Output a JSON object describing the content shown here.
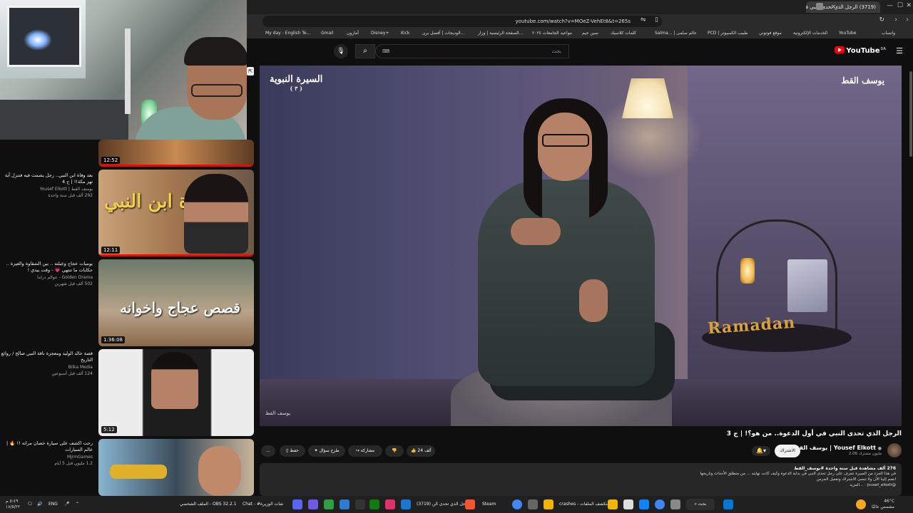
{
  "browser": {
    "tab_title": "(3719) الرجل الذي تحدى النبي في",
    "url": "youtube.com/watch?v=MOeZ-VehEt8&t=265s",
    "bookmarks": [
      "My day - English Te...",
      "Gmail",
      "أمازون",
      "Disney+",
      "Kick",
      "الوديجات | أفضل برن...",
      "الصفحة الرئيسية | وزار...",
      "مواعيد الجامعات ٢٠٢٤",
      "سين جيم",
      "كلمات كلاسيك",
      "Salma... | عالم سلمى",
      "PCD | طبيب الكمبيوتر",
      "موقع فوتوني",
      "الخدمات الإلكترونية",
      "YouTube",
      "واتساب"
    ]
  },
  "youtube": {
    "logo": "YouTube",
    "logo_region": "SA",
    "search_placeholder": "بحث"
  },
  "video": {
    "overlay_title": "السيرة النبوية",
    "overlay_sub": "( ٣ )",
    "channel_logo": "يوسف القط",
    "deco_text": "Ramadan",
    "watermark": "يوسف القط",
    "title": "الرجل الذي تحدى النبي في أول الدعوة.. من هو؟! | ج 3",
    "channel": "يوسف القط | Yousef Elkott",
    "subscribers": "2.06 مليون مشترك",
    "subscribe_label": "الاشتراك",
    "likes": "24 ألف",
    "share": "مشاركة",
    "ask": "طرح سؤال",
    "save": "حفظ",
    "more": "...",
    "desc_meta": "276 ألف مشاهدة  قبل سنة واحدة  #يوسف_القط",
    "desc_line1": "في هذا الجزء من السيرة نتعرف على رجل تحدى النبي في بداية الدعوة وكيف كانت نهايته ... من منطلق الأحداث وتاريخها",
    "desc_line2": "انضم إلينا الآن ولا تنسى الاشتراك وتفعيل الجرس",
    "desc_handle": "@jousef_elkott",
    "desc_more": "...المزيد"
  },
  "recommendations": [
    {
      "duration": "12:52",
      "title": "",
      "channel": "",
      "meta": ""
    },
    {
      "duration": "12:11",
      "title": "بعد وفاة ابن النبي.. رجل يشمت فيه فتنزل آية تهز مكة!! | ج 4",
      "channel": "يوسف القط | Yousef Elkott",
      "meta": "292 ألف  قبل سنة واحدة",
      "thumb_text": "وفاة ابن النبي"
    },
    {
      "duration": "1:36:08",
      "title": "يوميات عجاج وعيلته .. بين الشقاوة والغيرة .. حكايات ما تنتهي 💗 - وقت يبدي !",
      "channel": "Golden Drama - عوالم دراما",
      "meta": "502 ألف  قبل شهرين",
      "thumb_text": "قصص عجاج واخوانه"
    },
    {
      "duration": "5:12",
      "title": "قصة خالد الوليد ومعجزة ناقة النبي صالح / روائع التاريخ",
      "channel": "Bilka Media",
      "meta": "124 ألف  قبل أسبوعين",
      "thumb_text": ""
    },
    {
      "duration": "",
      "title": "رحت اكشف على سيارة حصان مراته !! 🔥 | عالم السيارات",
      "channel": "MjrmGames",
      "meta": "1.2 مليون  قبل 5 أيام",
      "thumb_text": ""
    }
  ],
  "taskbar": {
    "search": "بحث",
    "items": [
      "crashes - مستكشف الملفات",
      "Steam",
      "(3719) الرجل الذي تحدى الن",
      "Chat - #شات الوزيرة",
      "الملف الشخصي - OBS 32.2.1"
    ],
    "lang": "ENG",
    "time": "٥:٤٩ م",
    "date": "١٨/٥/٢٢",
    "weather_temp": "46°C",
    "weather_text": "مشمس غالبًا"
  },
  "colors": {
    "accent": "#ff0000",
    "bg": "#0f0f0f"
  }
}
